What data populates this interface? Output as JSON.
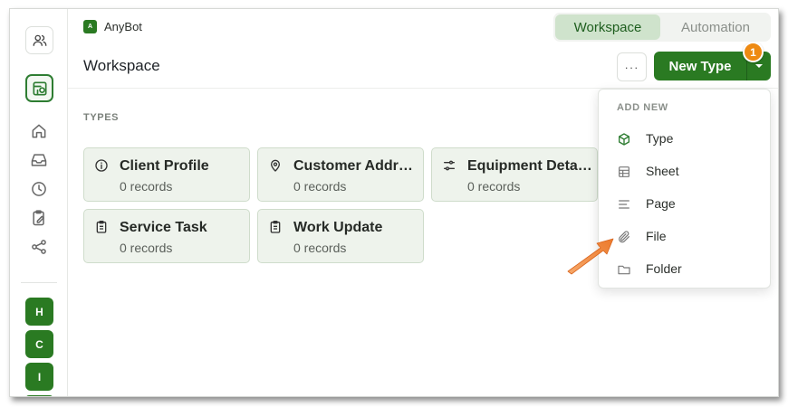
{
  "app": {
    "name": "AnyBot",
    "logo_letter": "A"
  },
  "top_tabs": [
    {
      "label": "Workspace",
      "active": true
    },
    {
      "label": "Automation",
      "active": false
    }
  ],
  "header": {
    "title": "Workspace",
    "more_label": "···",
    "new_button_label": "New Type",
    "step_badge": "1"
  },
  "sidebar": {
    "icons": [
      "people-icon",
      "database-icon",
      "home-icon",
      "inbox-icon",
      "clock-icon",
      "clipboard-edit-icon",
      "share-icon"
    ],
    "workspaces": [
      "H",
      "C",
      "I"
    ]
  },
  "types_section": {
    "label": "TYPES",
    "cards": [
      {
        "title": "Client Profile",
        "subtitle": "0 records",
        "icon": "info-icon"
      },
      {
        "title": "Customer Address",
        "subtitle": "0 records",
        "icon": "location-pin-icon"
      },
      {
        "title": "Equipment Details",
        "subtitle": "0 records",
        "icon": "sliders-icon"
      },
      {
        "title": "Service Task",
        "subtitle": "0 records",
        "icon": "clipboard-icon"
      },
      {
        "title": "Work Update",
        "subtitle": "0 records",
        "icon": "clipboard-icon"
      }
    ]
  },
  "dropdown": {
    "title": "ADD NEW",
    "items": [
      {
        "label": "Type",
        "icon": "cube-icon"
      },
      {
        "label": "Sheet",
        "icon": "table-icon"
      },
      {
        "label": "Page",
        "icon": "text-lines-icon"
      },
      {
        "label": "File",
        "icon": "paperclip-icon"
      },
      {
        "label": "Folder",
        "icon": "folder-icon"
      }
    ]
  },
  "colors": {
    "accent": "#2a7a22",
    "accent_light": "#cfe3cc",
    "card_bg": "#eef3ec",
    "badge": "#ee8a12",
    "pointer_arrow": "#f08a3c"
  }
}
